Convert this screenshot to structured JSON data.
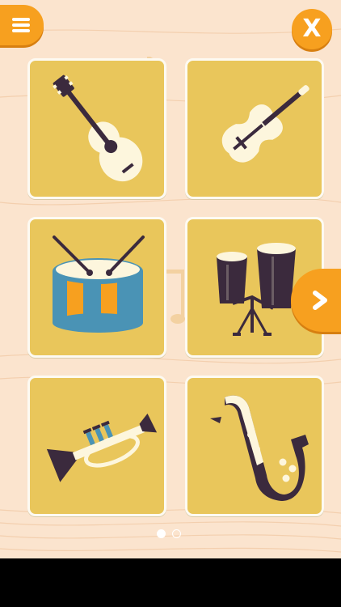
{
  "header": {
    "menu_icon": "hamburger-menu-icon",
    "close_label": "X"
  },
  "instruments": [
    {
      "name": "guitar",
      "icon": "guitar-icon"
    },
    {
      "name": "violin",
      "icon": "violin-icon"
    },
    {
      "name": "snare drum",
      "icon": "drum-icon"
    },
    {
      "name": "bongos",
      "icon": "bongo-drums-icon"
    },
    {
      "name": "trumpet",
      "icon": "trumpet-icon"
    },
    {
      "name": "saxophone",
      "icon": "saxophone-icon"
    }
  ],
  "pagination": {
    "current_page": 1,
    "total_pages": 2
  },
  "next_icon": "chevron-right-icon",
  "colors": {
    "background": "#fbe4ce",
    "accent_orange": "#f7a01f",
    "tile_yellow": "#e9c65b",
    "tile_border": "#fdfaf2",
    "instrument_dark": "#3b2a3d",
    "instrument_light": "#fdf6dd",
    "drum_blue": "#4a93b5"
  }
}
